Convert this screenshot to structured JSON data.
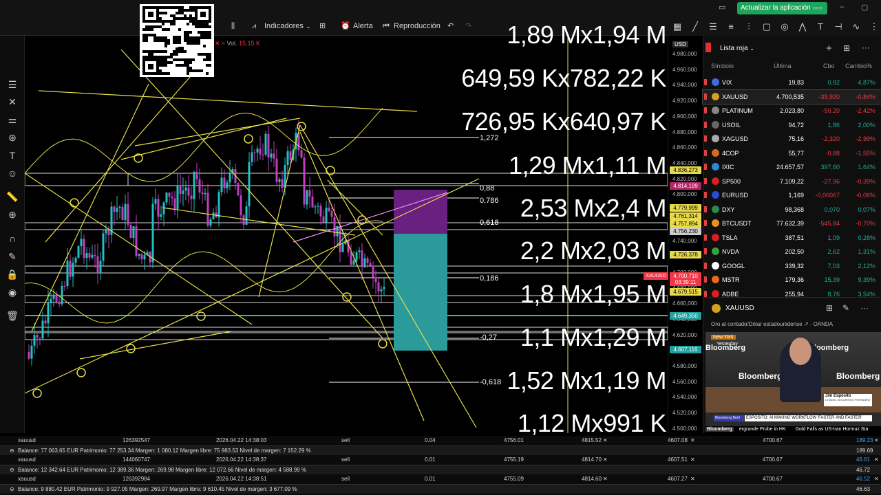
{
  "topbar": {
    "upgrade_label": "Actualizar la aplicación",
    "dots": "○○○"
  },
  "toolbar": {
    "indicators": "Indicadores",
    "alert": "Alerta",
    "replay": "Reproducción"
  },
  "volume": {
    "label": "Vol.",
    "value": "15,15 K"
  },
  "big_labels": [
    "1,89 Mx1,94 M",
    "649,59 Kx782,22 K",
    "726,95 Kx640,97 K",
    "1,29 Mx1,11 M",
    "2,53 Mx2,4 M",
    "2,2 Mx2,03 M",
    "1,8 Mx1,95 M",
    "1,1 Mx1,29 M",
    "1,52 Mx1,19 M",
    "1,12 Mx991 K"
  ],
  "fib_labels": [
    "1,272",
    "0,88",
    "0,786",
    "0,618",
    "0,186",
    "-0,27",
    "-0,618"
  ],
  "price_axis": {
    "currency": "USD",
    "ticks": [
      "4.980,000",
      "4.960,000",
      "4.940,000",
      "4.920,000",
      "4.900,000",
      "4.880,000",
      "4.860,000",
      "4.840,000",
      "4.820,000",
      "4.800,000",
      "4.780,000",
      "4.760,000",
      "4.740,000",
      "4.720,000",
      "4.700,000",
      "4.680,000",
      "4.660,000",
      "4.640,000",
      "4.620,000",
      "4.600,000",
      "4.580,000",
      "4.560,000",
      "4.540,000",
      "4.520,000",
      "4.500,000"
    ],
    "tags": [
      {
        "text": "4.836,273",
        "color": "#e8d94a"
      },
      {
        "text": "4.814,199",
        "color": "#b8246a"
      },
      {
        "text": "4.779,999",
        "color": "#e8d94a"
      },
      {
        "text": "4.761,314",
        "color": "#e8d94a"
      },
      {
        "text": "4.757,894",
        "color": "#e8d94a"
      },
      {
        "text": "4.756,230",
        "color": "#cccccc"
      },
      {
        "text": "4.726,378",
        "color": "#e8d94a"
      },
      {
        "text": "4.700,710",
        "color": "#f23645"
      },
      {
        "text": "03:39:11",
        "color": "#f23645"
      },
      {
        "text": "4.679,515",
        "color": "#e8d94a"
      },
      {
        "text": "4.649,350",
        "color": "#22a0a0"
      },
      {
        "text": "4.607,116",
        "color": "#22a0a0"
      }
    ],
    "symbol_tag": "XAUUSD"
  },
  "watchlist": {
    "title": "Lista roja",
    "columns": [
      "Símbolo",
      "Última",
      "Cbo",
      "Cambio%"
    ],
    "rows": [
      {
        "symbol": "VIX",
        "last": "19,83",
        "chg": "0,92",
        "pct": "4,87%",
        "dir": "up",
        "icon": "#3b6fd8"
      },
      {
        "symbol": "XAUUSD",
        "last": "4.700,535",
        "chg": "-39,920",
        "pct": "-0,84%",
        "dir": "dn",
        "icon": "#d4a020"
      },
      {
        "symbol": "PLATINUM",
        "last": "2.023,80",
        "chg": "-50,20",
        "pct": "-2,42%",
        "dir": "dn",
        "icon": "#888888"
      },
      {
        "symbol": "USOIL",
        "last": "94,72",
        "chg": "1,86",
        "pct": "2,00%",
        "dir": "up",
        "icon": "#666666"
      },
      {
        "symbol": "XAGUSD",
        "last": "75,16",
        "chg": "-2,320",
        "pct": "-2,99%",
        "dir": "dn",
        "icon": "#aaaaaa"
      },
      {
        "symbol": "4COP",
        "last": "55,77",
        "chg": "-0,88",
        "pct": "-1,55%",
        "dir": "dn",
        "icon": "#d46a20"
      },
      {
        "symbol": "IXIC",
        "last": "24.657,57",
        "chg": "397,60",
        "pct": "1,64%",
        "dir": "up",
        "icon": "#2a8ad4"
      },
      {
        "symbol": "SP500",
        "last": "7.109,22",
        "chg": "-27,96",
        "pct": "-0,39%",
        "dir": "dn",
        "icon": "#d42020"
      },
      {
        "symbol": "EURUSD",
        "last": "1,169",
        "chg": "-0,00067",
        "pct": "-0,06%",
        "dir": "dn",
        "icon": "#2a4ad4"
      },
      {
        "symbol": "DXY",
        "last": "98,368",
        "chg": "0,070",
        "pct": "0,07%",
        "dir": "up",
        "icon": "#2a8a4a"
      },
      {
        "symbol": "BTCUSDT",
        "last": "77.632,39",
        "chg": "-545,84",
        "pct": "-0,70%",
        "dir": "dn",
        "icon": "#e8901a"
      },
      {
        "symbol": "TSLA",
        "last": "387,51",
        "chg": "1,09",
        "pct": "0,28%",
        "dir": "up",
        "icon": "#d42020"
      },
      {
        "symbol": "NVDA",
        "last": "202,50",
        "chg": "2,62",
        "pct": "1,31%",
        "dir": "up",
        "icon": "#3aa03a"
      },
      {
        "symbol": "GOOGL",
        "last": "339,32",
        "chg": "7,03",
        "pct": "2,12%",
        "dir": "up",
        "icon": "#ffffff"
      },
      {
        "symbol": "MSTR",
        "last": "179,36",
        "chg": "15,39",
        "pct": "9,39%",
        "dir": "up",
        "icon": "#e86a1a"
      },
      {
        "symbol": "ADBE",
        "last": "255,94",
        "chg": "8,76",
        "pct": "3,54%",
        "dir": "up",
        "icon": "#d42020"
      }
    ]
  },
  "detail": {
    "symbol": "XAUUSD",
    "description": "Oro al contado/Dólar estadounidense",
    "source": "OANDA"
  },
  "video": {
    "location": "New York",
    "time": "Yesterday",
    "brand": "Bloomberg",
    "name": "Jim Esposito",
    "title": "CITADEL SECURITIES PRESIDENT",
    "segment": "Bloomberg Brief",
    "headline": "ESPOSITO: AI MAKING WORKFLOW 'FASTER AND FASTER'",
    "ticker_brand": "Bloomberg",
    "ticker_a": "ergrande Probe in HK",
    "ticker_b": "Gold Falls as US-Iran Hormuz Sta"
  },
  "positions": [
    {
      "symbol": "xauusd",
      "id": "126392547",
      "time": "2026.04.22 14:38:03",
      "side": "sell",
      "vol": "0.04",
      "open": "4756.01",
      "sl": "4815.52",
      "tp": "4607.08",
      "price": "4700.67",
      "pl": "189.23",
      "balance": "Balance: 77 063.65 EUR  Patrimonio: 77 253.34  Margen: 1 080.12  Margen libre: 75 983.53  Nivel de margen: 7 152.29 %",
      "total": "189.69"
    },
    {
      "symbol": "xauusd",
      "id": "144060747",
      "time": "2026.04.22 14:38:37",
      "side": "sell",
      "vol": "0.01",
      "open": "4755.19",
      "sl": "4814.70",
      "tp": "4607.51",
      "price": "4700.67",
      "pl": "46.61",
      "balance": "Balance: 12 342.64 EUR  Patrimonio: 12 389.36  Margen: 269.98  Margen libre: 12 072.66  Nivel de margen: 4 588.99 %",
      "total": "46.72"
    },
    {
      "symbol": "xauusd",
      "id": "126392984",
      "time": "2026.04.22 14:38:51",
      "side": "sell",
      "vol": "0.01",
      "open": "4755.09",
      "sl": "4814.60",
      "tp": "4607.27",
      "price": "4700.67",
      "pl": "46.52",
      "balance": "Balance: 9 880.42 EUR  Patrimonio: 9 927.05  Margen: 269.97  Margen libre: 9 610.45  Nivel de margen: 3 677.09 %",
      "total": "46.63"
    }
  ]
}
